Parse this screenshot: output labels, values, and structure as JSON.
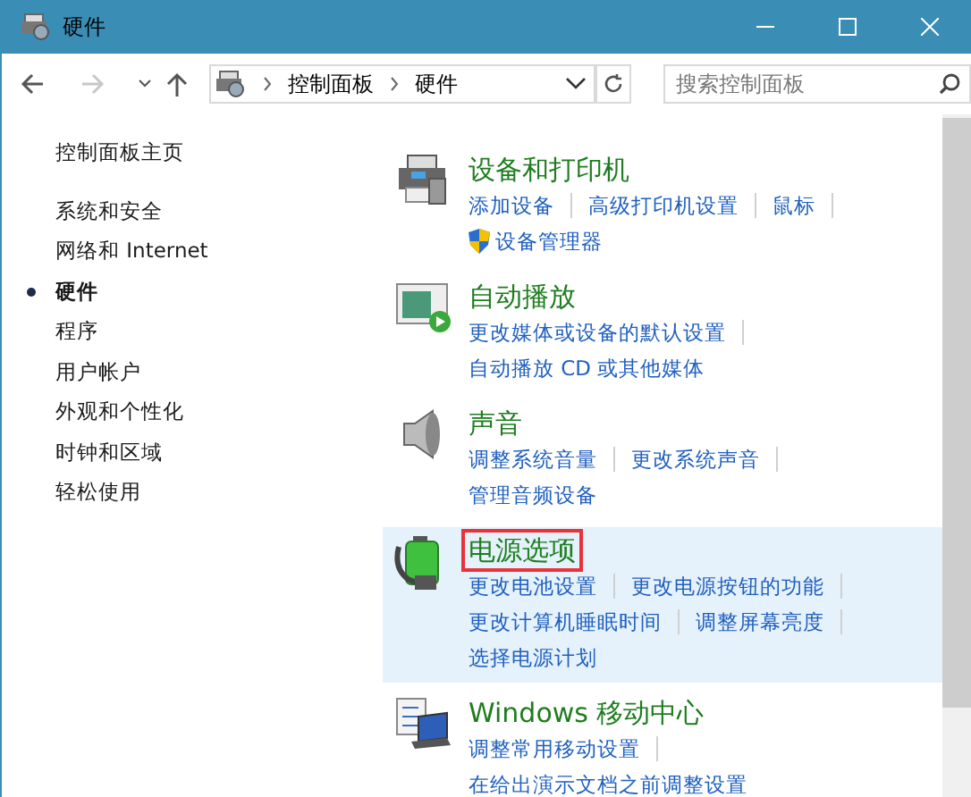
{
  "window": {
    "title": "硬件"
  },
  "address": {
    "path": [
      {
        "label": "控制面板"
      },
      {
        "label": "硬件"
      }
    ]
  },
  "search": {
    "placeholder": "搜索控制面板"
  },
  "sidebar": {
    "home": "控制面板主页",
    "items": [
      {
        "label": "系统和安全",
        "selected": false
      },
      {
        "label": "网络和 Internet",
        "selected": false
      },
      {
        "label": "硬件",
        "selected": true
      },
      {
        "label": "程序",
        "selected": false
      },
      {
        "label": "用户帐户",
        "selected": false
      },
      {
        "label": "外观和个性化",
        "selected": false
      },
      {
        "label": "时钟和区域",
        "selected": false
      },
      {
        "label": "轻松使用",
        "selected": false
      }
    ]
  },
  "categories": [
    {
      "kind": "printer",
      "title": "设备和打印机",
      "hovered": false,
      "highlighted": false,
      "rows": [
        [
          {
            "text": "添加设备",
            "shield": false
          },
          {
            "text": "高级打印机设置",
            "shield": false
          },
          {
            "text": "鼠标",
            "shield": false
          }
        ],
        [
          {
            "text": "设备管理器",
            "shield": true
          }
        ]
      ]
    },
    {
      "kind": "autoplay",
      "title": "自动播放",
      "hovered": false,
      "highlighted": false,
      "rows": [
        [
          {
            "text": "更改媒体或设备的默认设置",
            "shield": false
          }
        ],
        [
          {
            "text": "自动播放 CD 或其他媒体",
            "shield": false
          }
        ]
      ]
    },
    {
      "kind": "speaker",
      "title": "声音",
      "hovered": false,
      "highlighted": false,
      "rows": [
        [
          {
            "text": "调整系统音量",
            "shield": false
          },
          {
            "text": "更改系统声音",
            "shield": false
          }
        ],
        [
          {
            "text": "管理音频设备",
            "shield": false
          }
        ]
      ]
    },
    {
      "kind": "battery",
      "title": "电源选项",
      "hovered": true,
      "highlighted": true,
      "rows": [
        [
          {
            "text": "更改电池设置",
            "shield": false
          },
          {
            "text": "更改电源按钮的功能",
            "shield": false
          }
        ],
        [
          {
            "text": "更改计算机睡眠时间",
            "shield": false
          },
          {
            "text": "调整屏幕亮度",
            "shield": false
          }
        ],
        [
          {
            "text": "选择电源计划",
            "shield": false
          }
        ]
      ]
    },
    {
      "kind": "laptop",
      "title": "Windows 移动中心",
      "hovered": false,
      "highlighted": false,
      "rows": [
        [
          {
            "text": "调整常用移动设置",
            "shield": false
          }
        ],
        [
          {
            "text": "在给出演示文档之前调整设置",
            "shield": false
          }
        ]
      ]
    }
  ]
}
